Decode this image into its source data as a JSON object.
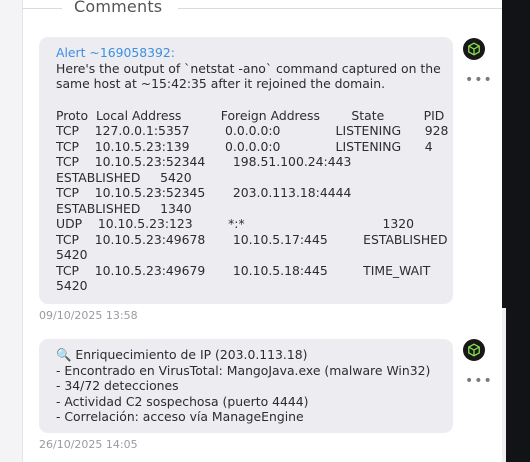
{
  "section": {
    "title": "Comments"
  },
  "comments": [
    {
      "author": "Alert ~169058392:",
      "lines": [
        "Here's the output of `netstat -ano` command captured on the",
        "same host at ~15:42:35 after it rejoined the domain.",
        "",
        "Proto  Local Address          Foreign Address        State          PID",
        "TCP    127.0.0.1:5357         0.0.0.0:0              LISTENING      928",
        "TCP    10.10.5.23:139         0.0.0.0:0              LISTENING      4",
        "TCP    10.10.5.23:52344       198.51.100.24:443",
        "ESTABLISHED     5420",
        "TCP    10.10.5.23:52345       203.0.113.18:4444",
        "ESTABLISHED     1340",
        "UDP    10.10.5.23:123         *:*                                   1320",
        "TCP    10.10.5.23:49678       10.10.5.17:445         ESTABLISHED",
        "5420",
        "TCP    10.10.5.23:49679       10.10.5.18:445         TIME_WAIT",
        "5420"
      ],
      "timestamp": "09/10/2025 13:58",
      "badge_icon": "cube-icon",
      "menu_icon": "more-options-icon"
    },
    {
      "author": "",
      "lines": [
        "🔍 Enriquecimiento de IP (203.0.113.18)",
        "- Encontrado en VirusTotal: MangoJava.exe (malware Win32)",
        "- 34/72 detecciones",
        "- Actividad C2 sospechosa (puerto 4444)",
        "- Correlación: acceso vía ManageEngine"
      ],
      "timestamp": "26/10/2025 14:05",
      "badge_icon": "cube-icon",
      "menu_icon": "more-options-icon"
    }
  ],
  "colors": {
    "author_link": "#3d8fe0",
    "bubble_bg": "#ededf1",
    "badge_bg": "#181818",
    "badge_icon": "#8be04e"
  }
}
